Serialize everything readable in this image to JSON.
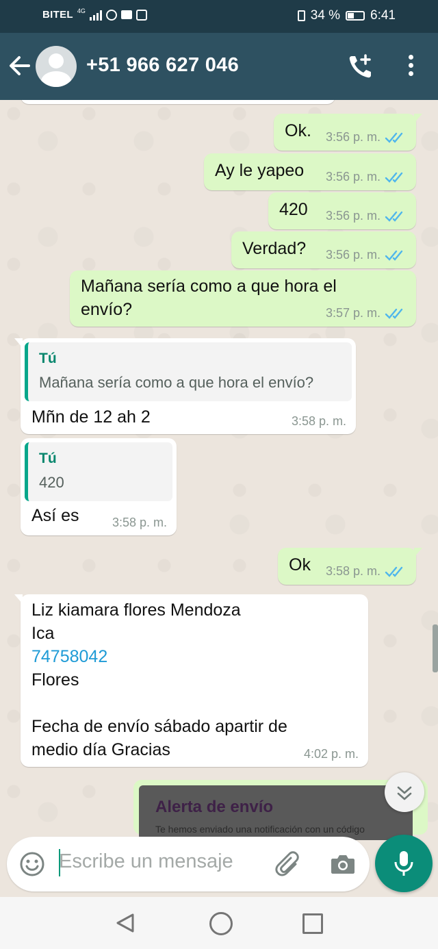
{
  "status_bar": {
    "carrier": "BITEL",
    "network": "4G",
    "battery": "34 %",
    "time": "6:41"
  },
  "header": {
    "contact": "+51 966 627 046"
  },
  "messages": [
    {
      "dir": "out",
      "text": "Ok.",
      "time": "3:56 p. m."
    },
    {
      "dir": "out",
      "text": "Ay le yapeo",
      "time": "3:56 p. m."
    },
    {
      "dir": "out",
      "text": "420",
      "time": "3:56 p. m."
    },
    {
      "dir": "out",
      "text": "Verdad?",
      "time": "3:56 p. m."
    },
    {
      "dir": "out",
      "text_line1": "Mañana sería como a que hora el",
      "text_line2": "envío?",
      "time": "3:57 p. m."
    },
    {
      "dir": "in",
      "quote_author": "Tú",
      "quote_text": "Mañana sería como a que hora el envío?",
      "text": "Mñn de 12 ah 2",
      "time": "3:58 p. m."
    },
    {
      "dir": "in",
      "quote_author": "Tú",
      "quote_text": "420",
      "text": "Así es",
      "time": "3:58 p. m."
    },
    {
      "dir": "out",
      "text": "Ok",
      "time": "3:58 p. m."
    },
    {
      "dir": "in",
      "line1": "Liz kiamara flores Mendoza",
      "line2": "Ica",
      "line3": "74758042",
      "line4": "Flores",
      "line5": "Fecha de envío sábado apartir de",
      "line6": "medio día Gracias",
      "time": "4:02 p. m."
    }
  ],
  "alert_card": {
    "title": "Alerta de envío",
    "subtitle": "Te hemos enviado una notificación con un código"
  },
  "input": {
    "placeholder": "Escribe un mensaje"
  },
  "colors": {
    "header": "#2e5161",
    "status_bar": "#1f3b48",
    "outgoing_bubble": "#dcf8c6",
    "incoming_bubble": "#ffffff",
    "accent": "#0b8d79",
    "read_ticks": "#4fb6ec",
    "link": "#1f9bd6"
  },
  "icons": [
    "back-arrow-icon",
    "avatar-icon",
    "add-call-icon",
    "more-options-icon",
    "emoji-icon",
    "attach-icon",
    "camera-icon",
    "microphone-icon",
    "scroll-down-icon",
    "nav-back-icon",
    "nav-home-icon",
    "nav-recent-icon"
  ]
}
